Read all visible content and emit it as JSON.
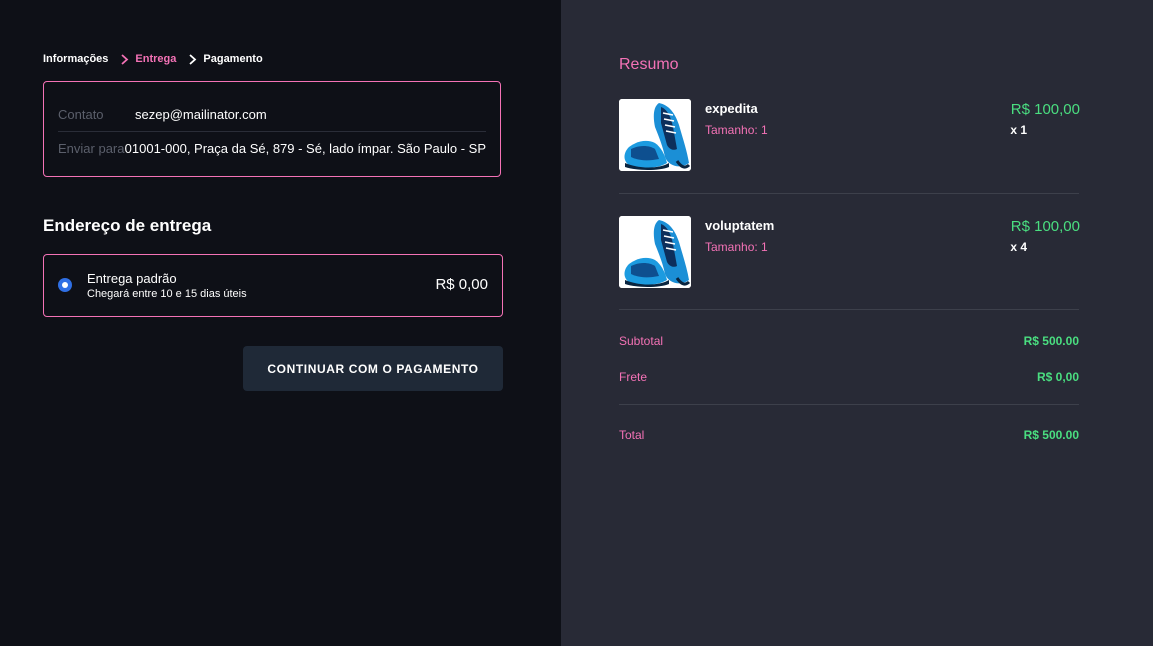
{
  "breadcrumb": {
    "items": [
      {
        "label": "Informações",
        "active": false
      },
      {
        "label": "Entrega",
        "active": true
      },
      {
        "label": "Pagamento",
        "active": false
      }
    ]
  },
  "contact": {
    "contact_label": "Contato",
    "contact_value": "sezep@mailinator.com",
    "ship_to_label": "Enviar para",
    "ship_to_value": "01001-000, Praça da Sé, 879 - Sé, lado ímpar. São Paulo - SP"
  },
  "delivery": {
    "title": "Endereço de entrega",
    "option": {
      "name": "Entrega padrão",
      "description": "Chegará entre 10 e 15 dias úteis",
      "price": "R$ 0,00",
      "selected": true
    },
    "continue_label": "CONTINUAR COM O PAGAMENTO"
  },
  "summary": {
    "title": "Resumo",
    "items": [
      {
        "name": "expedita",
        "size": "Tamanho: 1",
        "price": "R$ 100,00",
        "qty": "x 1",
        "icon": "sneaker-image"
      },
      {
        "name": "voluptatem",
        "size": "Tamanho: 1",
        "price": "R$ 100,00",
        "qty": "x 4",
        "icon": "sneaker-image"
      }
    ],
    "subtotal_label": "Subtotal",
    "subtotal_value": "R$ 500.00",
    "shipping_label": "Frete",
    "shipping_value": "R$ 0,00",
    "total_label": "Total",
    "total_value": "R$ 500.00"
  },
  "colors": {
    "accent": "#f472b6",
    "price": "#4ade80",
    "left_bg": "#0e1017",
    "right_bg": "#282a36",
    "button_bg": "#1f2937",
    "radio": "#2f6fe4"
  }
}
